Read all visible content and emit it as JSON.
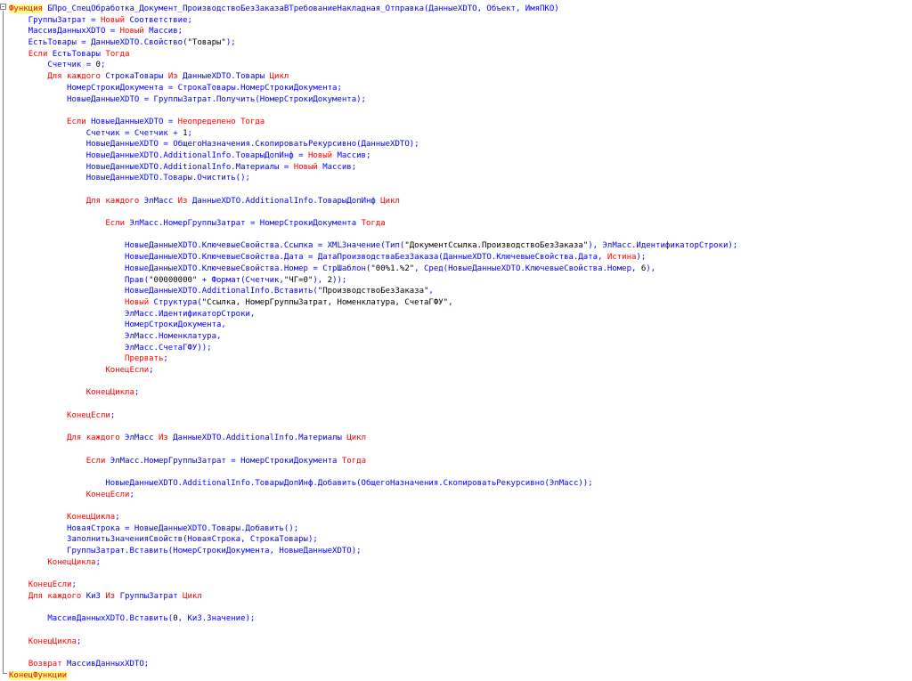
{
  "lines": [
    [
      {
        "t": "Функция",
        "c": "kw hl"
      },
      {
        "t": " БПро_СпецОбработка_Документ_ПроизводствоБезЗаказаВТребованиеНакладная_Отправка(ДанныеXDTO, Объект, ИмяПКО)",
        "c": "id"
      }
    ],
    [
      {
        "t": "    ГруппыЗатрат = ",
        "c": "id"
      },
      {
        "t": "Новый",
        "c": "kw"
      },
      {
        "t": " Соответствие;",
        "c": "id"
      }
    ],
    [
      {
        "t": "    МассивДанныхXDTO = ",
        "c": "id"
      },
      {
        "t": "Новый",
        "c": "kw"
      },
      {
        "t": " Массив;",
        "c": "id"
      }
    ],
    [
      {
        "t": "    ЕстьТовары = ДанныеXDTO.Свойство(",
        "c": "id"
      },
      {
        "t": "\"Товары\"",
        "c": "str"
      },
      {
        "t": ");",
        "c": "id"
      }
    ],
    [
      {
        "t": "    ",
        "c": "id"
      },
      {
        "t": "Если",
        "c": "kw"
      },
      {
        "t": " ЕстьТовары ",
        "c": "id"
      },
      {
        "t": "Тогда",
        "c": "kw"
      }
    ],
    [
      {
        "t": "        Счетчик = ",
        "c": "id"
      },
      {
        "t": "0",
        "c": "num"
      },
      {
        "t": ";",
        "c": "id"
      }
    ],
    [
      {
        "t": "        ",
        "c": "id"
      },
      {
        "t": "Для каждого",
        "c": "kw"
      },
      {
        "t": " СтрокаТовары ",
        "c": "id"
      },
      {
        "t": "Из",
        "c": "kw"
      },
      {
        "t": " ДанныеXDTO.Товары ",
        "c": "id"
      },
      {
        "t": "Цикл",
        "c": "kw"
      }
    ],
    [
      {
        "t": "            НомерСтрокиДокумента = СтрокаТовары.НомерСтрокиДокумента;",
        "c": "id"
      }
    ],
    [
      {
        "t": "            НовыеДанныеXDTO = ГруппыЗатрат.Получить(НомерСтрокиДокумента);",
        "c": "id"
      }
    ],
    [
      {
        "t": "",
        "c": "id"
      }
    ],
    [
      {
        "t": "            ",
        "c": "id"
      },
      {
        "t": "Если",
        "c": "kw"
      },
      {
        "t": " НовыеДанныеXDTO = ",
        "c": "id"
      },
      {
        "t": "Неопределено",
        "c": "kw"
      },
      {
        "t": " ",
        "c": "id"
      },
      {
        "t": "Тогда",
        "c": "kw"
      }
    ],
    [
      {
        "t": "                Счетчик = Счетчик + ",
        "c": "id"
      },
      {
        "t": "1",
        "c": "num"
      },
      {
        "t": ";",
        "c": "id"
      }
    ],
    [
      {
        "t": "                НовыеДанныеXDTO = ОбщегоНазначения.СкопироватьРекурсивно(ДанныеXDTO);",
        "c": "id"
      }
    ],
    [
      {
        "t": "                НовыеДанныеXDTO.AdditionalInfo.ТоварыДопИнф = ",
        "c": "id"
      },
      {
        "t": "Новый",
        "c": "kw"
      },
      {
        "t": " Массив;",
        "c": "id"
      }
    ],
    [
      {
        "t": "                НовыеДанныеXDTO.AdditionalInfo.Материалы = ",
        "c": "id"
      },
      {
        "t": "Новый",
        "c": "kw"
      },
      {
        "t": " Массив;",
        "c": "id"
      }
    ],
    [
      {
        "t": "                НовыеДанныеXDTO.Товары.Очистить();",
        "c": "id"
      }
    ],
    [
      {
        "t": "",
        "c": "id"
      }
    ],
    [
      {
        "t": "                ",
        "c": "id"
      },
      {
        "t": "Для каждого",
        "c": "kw"
      },
      {
        "t": " ЭлМасс ",
        "c": "id"
      },
      {
        "t": "Из",
        "c": "kw"
      },
      {
        "t": " ДанныеXDTO.AdditionalInfo.ТоварыДопИнф ",
        "c": "id"
      },
      {
        "t": "Цикл",
        "c": "kw"
      }
    ],
    [
      {
        "t": "",
        "c": "id"
      }
    ],
    [
      {
        "t": "                    ",
        "c": "id"
      },
      {
        "t": "Если",
        "c": "kw"
      },
      {
        "t": " ЭлМасс.НомерГруппыЗатрат = НомерСтрокиДокумента ",
        "c": "id"
      },
      {
        "t": "Тогда",
        "c": "kw"
      }
    ],
    [
      {
        "t": "",
        "c": "id"
      }
    ],
    [
      {
        "t": "                        НовыеДанныеXDTO.КлючевыеСвойства.Ссылка = XMLЗначение(Тип(",
        "c": "id"
      },
      {
        "t": "\"ДокументСсылка.ПроизводствоБезЗаказа\"",
        "c": "str"
      },
      {
        "t": "), ЭлМасс.ИдентификаторСтроки);",
        "c": "id"
      }
    ],
    [
      {
        "t": "                        НовыеДанныеXDTO.КлючевыеСвойства.Дата = ДатаПроизводстваБезЗаказа(ДанныеXDTO.КлючевыеСвойства.Дата, ",
        "c": "id"
      },
      {
        "t": "Истина",
        "c": "kw"
      },
      {
        "t": ");",
        "c": "id"
      }
    ],
    [
      {
        "t": "                        НовыеДанныеXDTO.КлючевыеСвойства.Номер = СтрШаблон(",
        "c": "id"
      },
      {
        "t": "\"00%1.%2\"",
        "c": "str"
      },
      {
        "t": ", Сред(НовыеДанныеXDTO.КлючевыеСвойства.Номер, ",
        "c": "id"
      },
      {
        "t": "6",
        "c": "num"
      },
      {
        "t": "),",
        "c": "id"
      }
    ],
    [
      {
        "t": "                        Прав(",
        "c": "id"
      },
      {
        "t": "\"00000000\"",
        "c": "str"
      },
      {
        "t": " + Формат(Счетчик,",
        "c": "id"
      },
      {
        "t": "\"ЧГ=0\"",
        "c": "str"
      },
      {
        "t": "), ",
        "c": "id"
      },
      {
        "t": "2",
        "c": "num"
      },
      {
        "t": "));",
        "c": "id"
      }
    ],
    [
      {
        "t": "                        НовыеДанныеXDTO.AdditionalInfo.Вставить(",
        "c": "id"
      },
      {
        "t": "\"ПроизводствоБезЗаказа\"",
        "c": "str"
      },
      {
        "t": ",",
        "c": "id"
      }
    ],
    [
      {
        "t": "                        ",
        "c": "id"
      },
      {
        "t": "Новый",
        "c": "kw"
      },
      {
        "t": " Структура(",
        "c": "id"
      },
      {
        "t": "\"Ссылка, НомерГруппыЗатрат, Номенклатура, СчетаГФУ\"",
        "c": "str"
      },
      {
        "t": ",",
        "c": "id"
      }
    ],
    [
      {
        "t": "                        ЭлМасс.ИдентификаторСтроки,",
        "c": "id"
      }
    ],
    [
      {
        "t": "                        НомерСтрокиДокумента,",
        "c": "id"
      }
    ],
    [
      {
        "t": "                        ЭлМасс.Номенклатура,",
        "c": "id"
      }
    ],
    [
      {
        "t": "                        ЭлМасс.СчетаГФУ));",
        "c": "id"
      }
    ],
    [
      {
        "t": "                        ",
        "c": "id"
      },
      {
        "t": "Прервать",
        "c": "kw"
      },
      {
        "t": ";",
        "c": "id"
      }
    ],
    [
      {
        "t": "                    ",
        "c": "id"
      },
      {
        "t": "КонецЕсли",
        "c": "kw"
      },
      {
        "t": ";",
        "c": "id"
      }
    ],
    [
      {
        "t": "",
        "c": "id"
      }
    ],
    [
      {
        "t": "                ",
        "c": "id"
      },
      {
        "t": "КонецЦикла",
        "c": "kw"
      },
      {
        "t": ";",
        "c": "id"
      }
    ],
    [
      {
        "t": "",
        "c": "id"
      }
    ],
    [
      {
        "t": "            ",
        "c": "id"
      },
      {
        "t": "КонецЕсли",
        "c": "kw"
      },
      {
        "t": ";",
        "c": "id"
      }
    ],
    [
      {
        "t": "",
        "c": "id"
      }
    ],
    [
      {
        "t": "            ",
        "c": "id"
      },
      {
        "t": "Для каждого",
        "c": "kw"
      },
      {
        "t": " ЭлМасс ",
        "c": "id"
      },
      {
        "t": "Из",
        "c": "kw"
      },
      {
        "t": " ДанныеXDTO.AdditionalInfo.Материалы ",
        "c": "id"
      },
      {
        "t": "Цикл",
        "c": "kw"
      }
    ],
    [
      {
        "t": "",
        "c": "id"
      }
    ],
    [
      {
        "t": "                ",
        "c": "id"
      },
      {
        "t": "Если",
        "c": "kw"
      },
      {
        "t": " ЭлМасс.НомерГруппыЗатрат = НомерСтрокиДокумента ",
        "c": "id"
      },
      {
        "t": "Тогда",
        "c": "kw"
      }
    ],
    [
      {
        "t": "",
        "c": "id"
      }
    ],
    [
      {
        "t": "                    НовыеДанныеXDTO.AdditionalInfo.ТоварыДопИнф.Добавить(ОбщегоНазначения.СкопироватьРекурсивно(ЭлМасс));",
        "c": "id"
      }
    ],
    [
      {
        "t": "                ",
        "c": "id"
      },
      {
        "t": "КонецЕсли",
        "c": "kw"
      },
      {
        "t": ";",
        "c": "id"
      }
    ],
    [
      {
        "t": "",
        "c": "id"
      }
    ],
    [
      {
        "t": "            ",
        "c": "id"
      },
      {
        "t": "КонецЦикла",
        "c": "kw"
      },
      {
        "t": ";",
        "c": "id"
      }
    ],
    [
      {
        "t": "            НоваяСтрока = НовыеДанныеXDTO.Товары.Добавить();",
        "c": "id"
      }
    ],
    [
      {
        "t": "            ЗаполнитьЗначенияСвойств(НоваяСтрока, СтрокаТовары);",
        "c": "id"
      }
    ],
    [
      {
        "t": "            ГруппыЗатрат.Вставить(НомерСтрокиДокумента, НовыеДанныеXDTO);",
        "c": "id"
      }
    ],
    [
      {
        "t": "        ",
        "c": "id"
      },
      {
        "t": "КонецЦикла",
        "c": "kw"
      },
      {
        "t": ";",
        "c": "id"
      }
    ],
    [
      {
        "t": "",
        "c": "id"
      }
    ],
    [
      {
        "t": "    ",
        "c": "id"
      },
      {
        "t": "КонецЕсли",
        "c": "kw"
      },
      {
        "t": ";",
        "c": "id"
      }
    ],
    [
      {
        "t": "    ",
        "c": "id"
      },
      {
        "t": "Для каждого",
        "c": "kw"
      },
      {
        "t": " КиЗ ",
        "c": "id"
      },
      {
        "t": "Из",
        "c": "kw"
      },
      {
        "t": " ГруппыЗатрат ",
        "c": "id"
      },
      {
        "t": "Цикл",
        "c": "kw"
      }
    ],
    [
      {
        "t": "",
        "c": "id"
      }
    ],
    [
      {
        "t": "        МассивДанныхXDTO.Вставить(",
        "c": "id"
      },
      {
        "t": "0",
        "c": "num"
      },
      {
        "t": ", КиЗ.Значение);",
        "c": "id"
      }
    ],
    [
      {
        "t": "",
        "c": "id"
      }
    ],
    [
      {
        "t": "    ",
        "c": "id"
      },
      {
        "t": "КонецЦикла",
        "c": "kw"
      },
      {
        "t": ";",
        "c": "id"
      }
    ],
    [
      {
        "t": "",
        "c": "id"
      }
    ],
    [
      {
        "t": "    ",
        "c": "id"
      },
      {
        "t": "Возврат",
        "c": "kw"
      },
      {
        "t": " МассивДанныхXDTO;",
        "c": "id"
      }
    ],
    [
      {
        "t": "КонецФункции",
        "c": "kw hl"
      }
    ]
  ],
  "colors": {
    "keyword": "#ff0000",
    "identifier": "#0000ff",
    "literal": "#000000",
    "highlight": "#ffff80"
  }
}
